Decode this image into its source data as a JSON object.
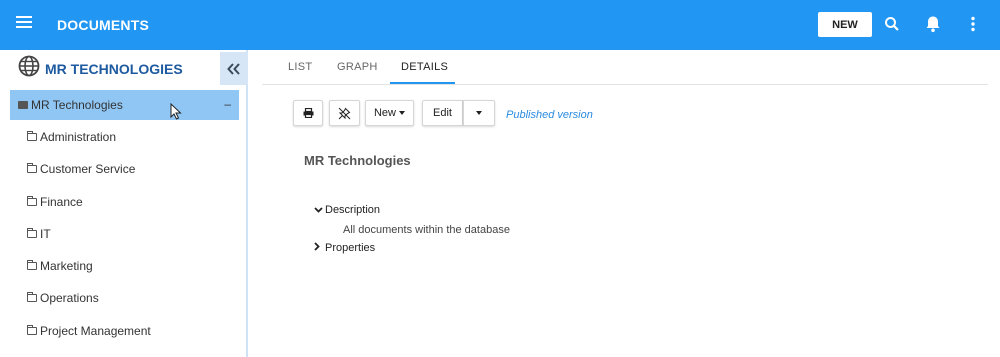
{
  "topbar": {
    "title": "DOCUMENTS",
    "new_label": "NEW",
    "icons": [
      "menu-icon",
      "search-icon",
      "bell-icon",
      "more-vert-icon"
    ]
  },
  "sidebar": {
    "org_title": "MR TECHNOLOGIES",
    "collapse_icon": "double-chevron-left-icon",
    "root": {
      "label": "MR Technologies",
      "toggle": "–"
    },
    "items": [
      {
        "label": "Administration"
      },
      {
        "label": "Customer Service"
      },
      {
        "label": "Finance"
      },
      {
        "label": "IT"
      },
      {
        "label": "Marketing"
      },
      {
        "label": "Operations"
      },
      {
        "label": "Project Management"
      }
    ]
  },
  "tabs": [
    {
      "label": "LIST"
    },
    {
      "label": "GRAPH"
    },
    {
      "label": "DETAILS"
    }
  ],
  "active_tab": "DETAILS",
  "toolbar": {
    "print_icon": "print-icon",
    "unpin_icon": "unpin-icon",
    "new_label": "New",
    "edit_label": "Edit",
    "status": "Published version"
  },
  "details": {
    "title": "MR Technologies",
    "description_label": "Description",
    "description_text": "All documents within the database",
    "properties_label": "Properties"
  },
  "colors": {
    "primary": "#2196f3",
    "selected_row": "#90c6f4",
    "org_title": "#1e5aa0",
    "link": "#2a8be0"
  }
}
